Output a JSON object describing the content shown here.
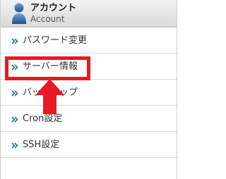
{
  "header": {
    "title": "アカウント",
    "subtitle": "Account",
    "icon": "user-icon"
  },
  "menu": {
    "items": [
      {
        "label": "パスワード変更"
      },
      {
        "label": "サーバー情報"
      },
      {
        "label": "バックアップ"
      },
      {
        "label": "Cron設定"
      },
      {
        "label": "SSH設定"
      }
    ]
  },
  "colors": {
    "highlight": "#e51a24",
    "arrow_bullet": "#2e6f8a"
  }
}
